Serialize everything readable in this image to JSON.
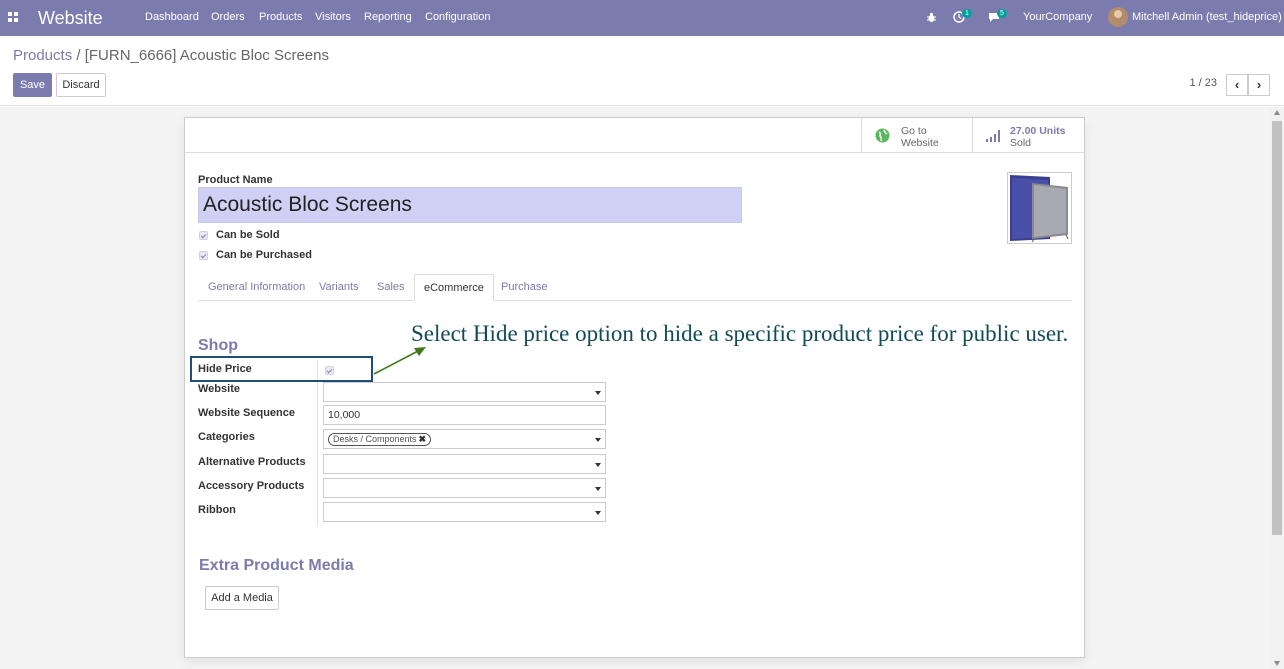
{
  "navbar": {
    "brand": "Website",
    "menus": [
      "Dashboard",
      "Orders",
      "Products",
      "Visitors",
      "Reporting",
      "Configuration"
    ],
    "activities_badge": "1",
    "messages_badge": "5",
    "company": "YourCompany",
    "user": "Mitchell Admin (test_hideprice)"
  },
  "breadcrumb": {
    "parent": "Products",
    "separator": "/",
    "current": "[FURN_6666] Acoustic Bloc Screens"
  },
  "buttons": {
    "save": "Save",
    "discard": "Discard"
  },
  "pager": {
    "value": "1 / 23",
    "prev_icon": "chevron-left-icon",
    "next_icon": "chevron-right-icon"
  },
  "smart_buttons": {
    "website_line1": "Go to",
    "website_line2": "Website",
    "sold_value": "27.00 Units",
    "sold_label": "Sold"
  },
  "form": {
    "product_name_label": "Product Name",
    "product_name": "Acoustic Bloc Screens",
    "can_be_sold": "Can be Sold",
    "can_be_purchased": "Can be Purchased"
  },
  "tabs": [
    "General Information",
    "Variants",
    "Sales",
    "eCommerce",
    "Purchase"
  ],
  "active_tab": "eCommerce",
  "shop": {
    "title": "Shop",
    "hide_price_label": "Hide Price",
    "website_label": "Website",
    "website_value": "",
    "sequence_label": "Website Sequence",
    "sequence_value": "10,000",
    "categories_label": "Categories",
    "category_tag": "Desks / Components",
    "alternative_label": "Alternative Products",
    "accessory_label": "Accessory Products",
    "ribbon_label": "Ribbon"
  },
  "extra_media": {
    "title": "Extra Product Media",
    "add_button": "Add a Media"
  },
  "annotation": "Select Hide price option to hide a specific product price for public user.",
  "colors": {
    "brand": "#7c7bad",
    "annotation": "#124a56",
    "highlight": "#1c4f7c",
    "arrow": "#3d7a1e"
  }
}
